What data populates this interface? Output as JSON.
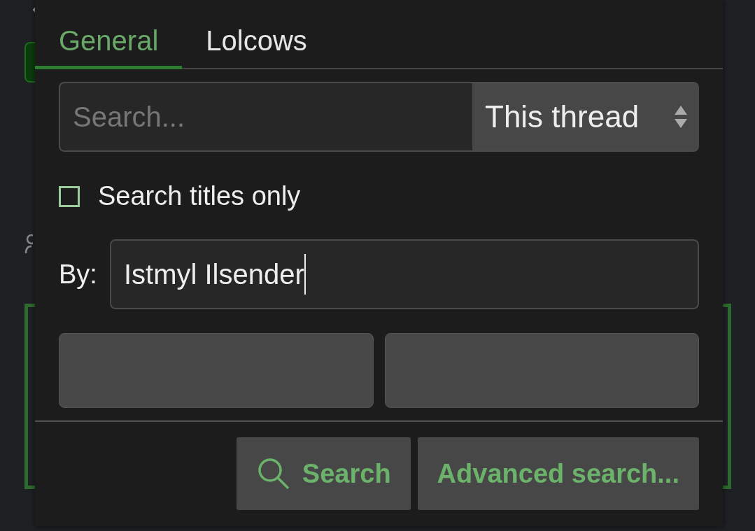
{
  "search_popup": {
    "tabs": [
      {
        "label": "General",
        "selected": true
      },
      {
        "label": "Lolcows",
        "selected": false
      }
    ],
    "search_field": {
      "placeholder": "Search..."
    },
    "scope_select": {
      "value": "This thread"
    },
    "titles_only": {
      "label": "Search titles only",
      "checked": false
    },
    "by_field": {
      "label": "By:",
      "value": "Istmyl Ilsender"
    },
    "buttons": [
      {
        "kind": "search",
        "label": "Search"
      },
      {
        "kind": "advanced",
        "label": "Advanced search..."
      }
    ]
  }
}
